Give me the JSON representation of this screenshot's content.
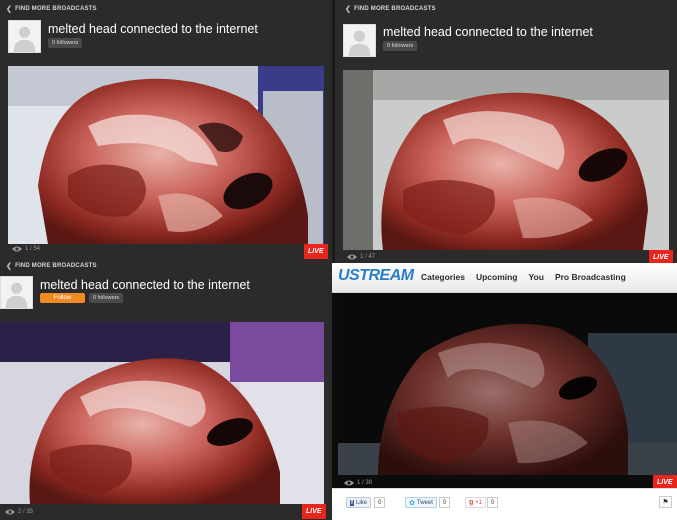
{
  "panels": [
    {
      "find_more": "FIND MORE BROADCASTS",
      "title": "melted head connected to the internet",
      "followers": "0 followers",
      "viewers": "1 / 54",
      "live": "LIVE"
    },
    {
      "find_more": "FIND MORE BROADCASTS",
      "title": "melted head connected to the internet",
      "followers": "0 followers",
      "viewers": "1 / 47",
      "live": "LIVE"
    },
    {
      "find_more": "FIND MORE BROADCASTS",
      "title": "melted head connected to the internet",
      "follow_button": "Follow",
      "followers": "0 followers",
      "viewers": "2 / 35",
      "live": "LIVE"
    },
    {
      "viewers": "1 / 38",
      "live": "LIVE"
    }
  ],
  "ustream": {
    "logo": "USTREAM",
    "nav": [
      "Categories",
      "Upcoming",
      "You",
      "Pro Broadcasting"
    ],
    "social": {
      "facebook_label": "Like",
      "facebook_count": "0",
      "twitter_label": "Tweet",
      "twitter_count": "0",
      "google_label": "+1",
      "google_count": "0"
    }
  },
  "colors": {
    "live_badge": "#e8261e",
    "follow_button": "#f08a24",
    "ustream_blue": "#2a7ec7",
    "panel_bg": "#2b2b2b"
  },
  "icons": [
    "chevron-left-icon",
    "user-silhouette-icon",
    "eye-icon",
    "flag-icon"
  ]
}
